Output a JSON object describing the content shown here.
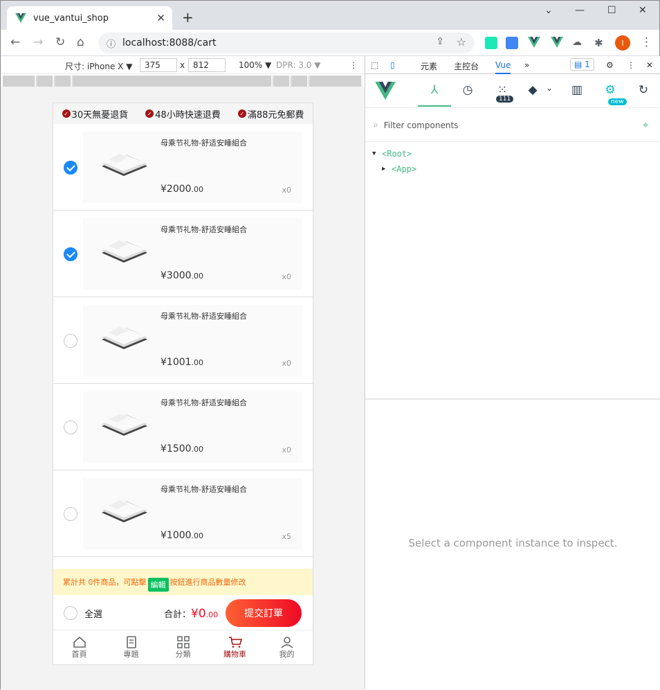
{
  "browser": {
    "tab_title": "vue_vantui_shop",
    "url": "localhost:8088/cart"
  },
  "device_bar": {
    "device": "尺寸: iPhone X ▼",
    "width": "375",
    "height": "812",
    "x": "x",
    "zoom": "100% ▼",
    "dpr": "DPR: 3.0 ▼"
  },
  "devtools": {
    "tabs": [
      "元素",
      "主控台",
      "Vue"
    ],
    "active_tab": "Vue",
    "more": "»",
    "issue_count": "1",
    "filter_placeholder": "Filter components",
    "badge_count": "111",
    "badge_new": "new",
    "tree": [
      "<Root>",
      "<App>"
    ],
    "inspect_hint": "Select a component instance to inspect."
  },
  "shop": {
    "promos": [
      "30天無憂退貨",
      "48小時快速退費",
      "滿88元免郵費"
    ],
    "items": [
      {
        "name": "母乘节礼物-舒适安睡組合",
        "price": "¥2000",
        "cents": ".00",
        "qty": "x0",
        "checked": true
      },
      {
        "name": "母乘节礼物-舒适安睡組合",
        "price": "¥3000",
        "cents": ".00",
        "qty": "x0",
        "checked": true
      },
      {
        "name": "母乘节礼物-舒适安睡組合",
        "price": "¥1001",
        "cents": ".00",
        "qty": "x0",
        "checked": false
      },
      {
        "name": "母乘节礼物-舒适安睡組合",
        "price": "¥1500",
        "cents": ".00",
        "qty": "x0",
        "checked": false
      },
      {
        "name": "母乘节礼物-舒适安睡組合",
        "price": "¥1000",
        "cents": ".00",
        "qty": "x5",
        "checked": false
      }
    ],
    "tip_before": "累計共 0件商品，可點擊",
    "tip_tag": "編輯",
    "tip_after": "按鈕進行商品數量修改",
    "select_all": "全選",
    "total_label": "合計：",
    "total_amount": "¥0",
    "total_cents": ".00",
    "submit": "提交訂單",
    "tabbar": [
      "首頁",
      "專題",
      "分類",
      "購物車",
      "我的"
    ],
    "tabbar_active": 3
  },
  "colors": {
    "primary_check": "#1989fa",
    "accent_red": "#a31515",
    "vue_green": "#42b883",
    "price_red": "#ee0a24"
  }
}
